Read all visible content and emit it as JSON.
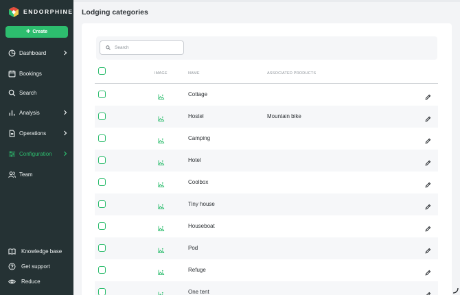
{
  "app": {
    "brand_name": "ENDORPHINE",
    "brand_colors": {
      "sidebar": "#253234",
      "accent": "#2dbd6e"
    }
  },
  "sidebar": {
    "create_label": "Create",
    "items": [
      {
        "label": "Dashboard",
        "icon": "pie-chart-icon",
        "has_chevron": true,
        "active": false
      },
      {
        "label": "Bookings",
        "icon": "calendar-icon",
        "has_chevron": false,
        "active": false
      },
      {
        "label": "Search",
        "icon": "search-icon",
        "has_chevron": false,
        "active": false
      },
      {
        "label": "Analysis",
        "icon": "bar-chart-icon",
        "has_chevron": true,
        "active": false
      },
      {
        "label": "Operations",
        "icon": "document-icon",
        "has_chevron": true,
        "active": false
      },
      {
        "label": "Configuration",
        "icon": "sliders-icon",
        "has_chevron": true,
        "active": true
      },
      {
        "label": "Team",
        "icon": "users-icon",
        "has_chevron": false,
        "active": false
      }
    ],
    "bottom_items": [
      {
        "label": "Knowledge base",
        "icon": "book-icon"
      },
      {
        "label": "Get support",
        "icon": "help-circle-icon"
      },
      {
        "label": "Reduce",
        "icon": "eye-icon"
      }
    ]
  },
  "main": {
    "title": "Lodging categories",
    "search": {
      "placeholder": "Search",
      "value": ""
    },
    "table": {
      "columns": [
        "IMAGE",
        "NAME",
        "ASSOCIATED PRODUCTS"
      ],
      "rows": [
        {
          "name": "Cottage",
          "associated": ""
        },
        {
          "name": "Hostel",
          "associated": "Mountain bike"
        },
        {
          "name": "Camping",
          "associated": ""
        },
        {
          "name": "Hotel",
          "associated": ""
        },
        {
          "name": "Coolbox",
          "associated": ""
        },
        {
          "name": "Tiny house",
          "associated": ""
        },
        {
          "name": "Houseboat",
          "associated": ""
        },
        {
          "name": "Pod",
          "associated": ""
        },
        {
          "name": "Refuge",
          "associated": ""
        },
        {
          "name": "One tent",
          "associated": ""
        }
      ]
    }
  }
}
